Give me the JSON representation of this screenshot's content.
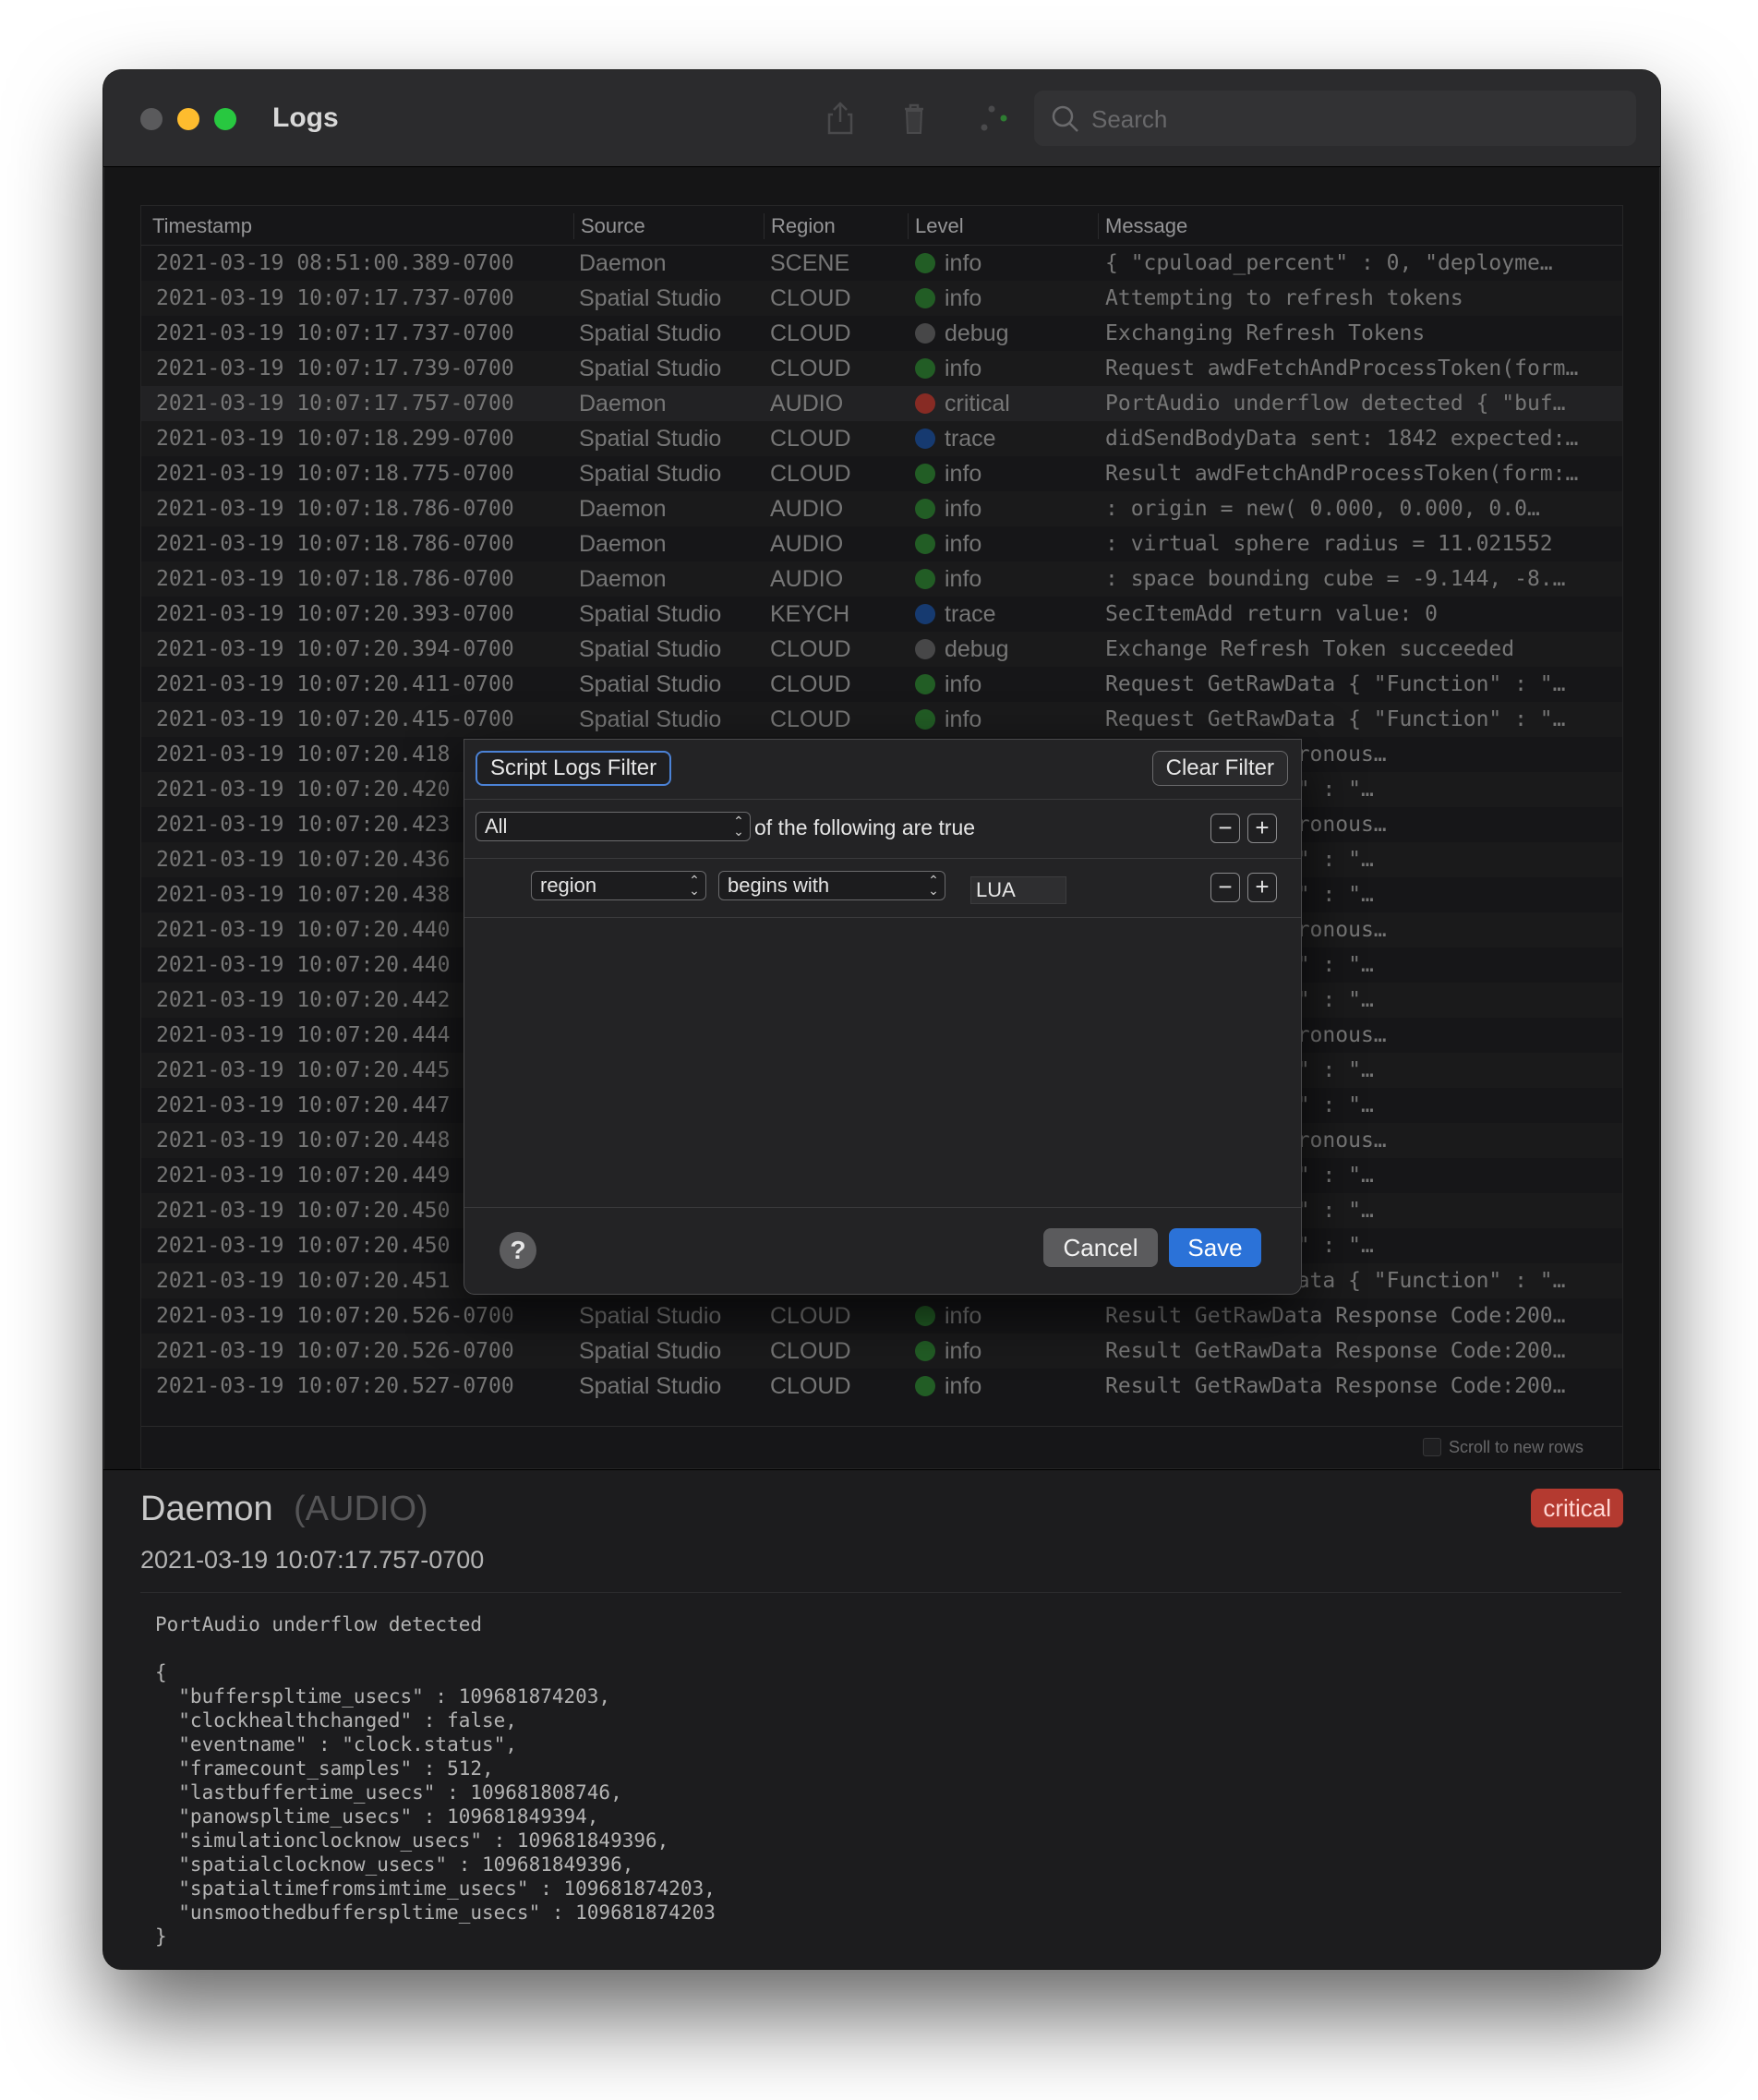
{
  "window": {
    "title": "Logs"
  },
  "toolbar": {
    "share_icon": "share-icon",
    "trash_icon": "trash-icon",
    "network_icon": "network-status-icon"
  },
  "search": {
    "placeholder": "Search"
  },
  "colors": {
    "info": "#2e7d32",
    "debug": "#5f5f61",
    "trace": "#1e4e96",
    "critical": "#b43a30"
  },
  "table": {
    "columns": [
      "Timestamp",
      "Source",
      "Region",
      "Level",
      "Message"
    ],
    "rows": [
      {
        "ts": "2021-03-19 08:51:00.389-0700",
        "src": "Daemon",
        "reg": "SCENE",
        "lvl": "info",
        "msg": "{  \"cpuload_percent\" : 0,  \"deployme…"
      },
      {
        "ts": "2021-03-19 10:07:17.737-0700",
        "src": "Spatial Studio",
        "reg": "CLOUD",
        "lvl": "info",
        "msg": "Attempting to refresh tokens"
      },
      {
        "ts": "2021-03-19 10:07:17.737-0700",
        "src": "Spatial Studio",
        "reg": "CLOUD",
        "lvl": "debug",
        "msg": "Exchanging Refresh Tokens"
      },
      {
        "ts": "2021-03-19 10:07:17.739-0700",
        "src": "Spatial Studio",
        "reg": "CLOUD",
        "lvl": "info",
        "msg": "Request awdFetchAndProcessToken(form…"
      },
      {
        "ts": "2021-03-19 10:07:17.757-0700",
        "src": "Daemon",
        "reg": "AUDIO",
        "lvl": "critical",
        "msg": "PortAudio underflow detected {  \"buf…"
      },
      {
        "ts": "2021-03-19 10:07:18.299-0700",
        "src": "Spatial Studio",
        "reg": "CLOUD",
        "lvl": "trace",
        "msg": "didSendBodyData sent: 1842 expected:…"
      },
      {
        "ts": "2021-03-19 10:07:18.775-0700",
        "src": "Spatial Studio",
        "reg": "CLOUD",
        "lvl": "info",
        "msg": "Result awdFetchAndProcessToken(form:…"
      },
      {
        "ts": "2021-03-19 10:07:18.786-0700",
        "src": "Daemon",
        "reg": "AUDIO",
        "lvl": "info",
        "msg": " : origin = new( 0.000,  0.000,  0.0…"
      },
      {
        "ts": "2021-03-19 10:07:18.786-0700",
        "src": "Daemon",
        "reg": "AUDIO",
        "lvl": "info",
        "msg": " : virtual sphere radius = 11.021552"
      },
      {
        "ts": "2021-03-19 10:07:18.786-0700",
        "src": "Daemon",
        "reg": "AUDIO",
        "lvl": "info",
        "msg": " : space bounding cube = -9.144, -8.…"
      },
      {
        "ts": "2021-03-19 10:07:20.393-0700",
        "src": "Spatial Studio",
        "reg": "KEYCH",
        "lvl": "trace",
        "msg": "SecItemAdd return value: 0"
      },
      {
        "ts": "2021-03-19 10:07:20.394-0700",
        "src": "Spatial Studio",
        "reg": "CLOUD",
        "lvl": "debug",
        "msg": "Exchange Refresh Token succeeded"
      },
      {
        "ts": "2021-03-19 10:07:20.411-0700",
        "src": "Spatial Studio",
        "reg": "CLOUD",
        "lvl": "info",
        "msg": "Request GetRawData {  \"Function\" : \"…"
      },
      {
        "ts": "2021-03-19 10:07:20.415-0700",
        "src": "Spatial Studio",
        "reg": "CLOUD",
        "lvl": "info",
        "msg": "Request GetRawData {  \"Function\" : \"…"
      },
      {
        "ts": "2021-03-19 10:07:20.418",
        "src": "",
        "reg": "",
        "lvl": "",
        "msg": "rning Data syncronous…"
      },
      {
        "ts": "2021-03-19 10:07:20.420",
        "src": "",
        "reg": "",
        "lvl": "",
        "msg": "ata {  \"Function\" : \"…"
      },
      {
        "ts": "2021-03-19 10:07:20.423",
        "src": "",
        "reg": "",
        "lvl": "",
        "msg": "rning Data syncronous…"
      },
      {
        "ts": "2021-03-19 10:07:20.436",
        "src": "",
        "reg": "",
        "lvl": "",
        "msg": "ata {  \"Function\" : \"…"
      },
      {
        "ts": "2021-03-19 10:07:20.438",
        "src": "",
        "reg": "",
        "lvl": "",
        "msg": "ata {  \"Function\" : \"…"
      },
      {
        "ts": "2021-03-19 10:07:20.440",
        "src": "",
        "reg": "",
        "lvl": "",
        "msg": "rning Data syncronous…"
      },
      {
        "ts": "2021-03-19 10:07:20.440",
        "src": "",
        "reg": "",
        "lvl": "",
        "msg": "ata {  \"Function\" : \"…"
      },
      {
        "ts": "2021-03-19 10:07:20.442",
        "src": "",
        "reg": "",
        "lvl": "",
        "msg": "ata {  \"Function\" : \"…"
      },
      {
        "ts": "2021-03-19 10:07:20.444",
        "src": "",
        "reg": "",
        "lvl": "",
        "msg": "rning Data syncronous…"
      },
      {
        "ts": "2021-03-19 10:07:20.445",
        "src": "",
        "reg": "",
        "lvl": "",
        "msg": "ata {  \"Function\" : \"…"
      },
      {
        "ts": "2021-03-19 10:07:20.447",
        "src": "",
        "reg": "",
        "lvl": "",
        "msg": "ata {  \"Function\" : \"…"
      },
      {
        "ts": "2021-03-19 10:07:20.448",
        "src": "",
        "reg": "",
        "lvl": "",
        "msg": "rning Data syncronous…"
      },
      {
        "ts": "2021-03-19 10:07:20.449",
        "src": "",
        "reg": "",
        "lvl": "",
        "msg": "ata {  \"Function\" : \"…"
      },
      {
        "ts": "2021-03-19 10:07:20.450",
        "src": "",
        "reg": "",
        "lvl": "",
        "msg": "ata {  \"Function\" : \"…"
      },
      {
        "ts": "2021-03-19 10:07:20.450",
        "src": "",
        "reg": "",
        "lvl": "",
        "msg": "ata {  \"Function\" : \"…"
      },
      {
        "ts": "2021-03-19 10:07:20.451",
        "src": "",
        "reg": "",
        "lvl": "",
        "msg": "Request GetRawData {  \"Function\" : \"…"
      },
      {
        "ts": "2021-03-19 10:07:20.526-0700",
        "src": "Spatial Studio",
        "reg": "CLOUD",
        "lvl": "info",
        "msg": "Result GetRawData Response Code:200…"
      },
      {
        "ts": "2021-03-19 10:07:20.526-0700",
        "src": "Spatial Studio",
        "reg": "CLOUD",
        "lvl": "info",
        "msg": "Result GetRawData Response Code:200…"
      },
      {
        "ts": "2021-03-19 10:07:20.527-0700",
        "src": "Spatial Studio",
        "reg": "CLOUD",
        "lvl": "info",
        "msg": "Result GetRawData Response Code:200…"
      }
    ],
    "selected_index": 4
  },
  "footer": {
    "scroll_label": "Scroll to new rows"
  },
  "detail": {
    "source": "Daemon",
    "region": "(AUDIO)",
    "level": "critical",
    "timestamp": "2021-03-19 10:07:17.757-0700",
    "message": "PortAudio underflow detected\n\n{\n  \"bufferspltime_usecs\" : 109681874203,\n  \"clockhealthchanged\" : false,\n  \"eventname\" : \"clock.status\",\n  \"framecount_samples\" : 512,\n  \"lastbuffertime_usecs\" : 109681808746,\n  \"panowspltime_usecs\" : 109681849394,\n  \"simulationclocknow_usecs\" : 109681849396,\n  \"spatialclocknow_usecs\" : 109681849396,\n  \"spatialtimefromsimtime_usecs\" : 109681874203,\n  \"unsmoothedbufferspltime_usecs\" : 109681874203\n}"
  },
  "sheet": {
    "title_button": "Script Logs Filter",
    "clear_button": "Clear Filter",
    "match_mode": "All",
    "match_text": "of the following are true",
    "criterion": {
      "field": "region",
      "operator": "begins with",
      "value": "LUA"
    },
    "help_label": "?",
    "cancel_label": "Cancel",
    "save_label": "Save",
    "minus_label": "−",
    "plus_label": "+"
  }
}
